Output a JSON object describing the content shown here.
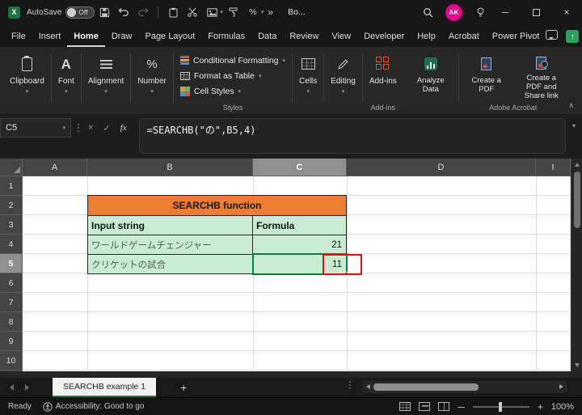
{
  "colors": {
    "excel_green": "#107C41",
    "table_header_orange": "#ED7D31",
    "table_body_green": "#C7ECD1",
    "annotation_red": "#E01414",
    "avatar_pink": "#E3008C"
  },
  "glyphs": {
    "logo": "X",
    "chevron": "▾",
    "chevron_up": "∧",
    "percent": "%",
    "font_a": "A",
    "fx": "fx",
    "more": "»",
    "plus": "+",
    "arrow_up": "↑",
    "minimize": "─",
    "close": "×",
    "cancel": "×",
    "enter": "✓"
  },
  "titlebar": {
    "autosave_label": "AutoSave",
    "autosave_state": "Off",
    "workbook_name": "Bo...",
    "avatar_initials": "AK"
  },
  "menubar": {
    "tabs": [
      "File",
      "Insert",
      "Home",
      "Draw",
      "Page Layout",
      "Formulas",
      "Data",
      "Review",
      "View",
      "Developer",
      "Help",
      "Acrobat",
      "Power Pivot"
    ],
    "active_tab": "Home"
  },
  "ribbon": {
    "clipboard": "Clipboard",
    "font": "Font",
    "alignment": "Alignment",
    "number": "Number",
    "conditional_formatting": "Conditional Formatting",
    "format_as_table": "Format as Table",
    "cell_styles": "Cell Styles",
    "styles_group": "Styles",
    "cells": "Cells",
    "editing": "Editing",
    "addins": "Add-ins",
    "addins_group": "Add-ins",
    "analyze_data": "Analyze Data",
    "create_pdf": "Create a PDF",
    "create_pdf_share": "Create a PDF and Share link",
    "acrobat_group": "Adobe Acrobat"
  },
  "formula_bar": {
    "name_box": "C5",
    "formula": "=SEARCHB(\"の\",B5,4)"
  },
  "sheet": {
    "columns": [
      "A",
      "B",
      "C",
      "D",
      "I"
    ],
    "rows": [
      "1",
      "2",
      "3",
      "4",
      "5",
      "6",
      "7",
      "8",
      "9",
      "10"
    ],
    "selected_cell": "C5",
    "table": {
      "title": "SEARCHB function",
      "col1_header": "Input string",
      "col2_header": "Formula",
      "row1_input": "ワールドゲームチェンジャー",
      "row1_value": "21",
      "row2_input": "クリケットの試合",
      "row2_value": "11"
    }
  },
  "sheet_tabs": {
    "active_tab": "SEARCHB example 1"
  },
  "status_bar": {
    "mode": "Ready",
    "accessibility": "Accessibility: Good to go",
    "zoom_level": "100%"
  }
}
